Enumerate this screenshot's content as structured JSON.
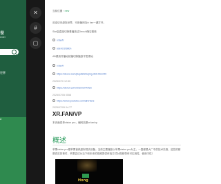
{
  "sidebar": {
    "title": "世",
    "subtitle": "enter",
    "link_text": "世界",
    "strip_text": "d"
  },
  "rail": {
    "buttons": [
      {
        "icon": "close-icon",
        "glyph": "✕"
      },
      {
        "icon": "hash-icon",
        "glyph": "#"
      },
      {
        "icon": "box-icon",
        "glyph": "▢"
      }
    ]
  },
  "breadcrumb": {
    "parent": "当前位置",
    "separator": "›",
    "current": "new"
  },
  "lines": [
    "欢迎访问虚拟世界，可用偏网址/v fan一键打开。",
    "Slot会直接切换着播放过Devc/v随空跳转",
    "v.fan/ir",
    "usend.station",
    "AB便用开播地前播切换播放平发现地",
    "v.fan/ir",
    "https://dexor.com/playlists/bejing-3b9-hbn249",
    "2025/07/0 12:50",
    "https://dexor.com/channel/4vfan",
    "2025/07/05 0558",
    "https://www.youtube.com/@vrfans",
    "2025/07/09 04:77"
  ],
  "domain_heading": "XR.FAN/VP",
  "domain_desc": "本页面菜单vision pro，偏网站是vr.fan/vp",
  "section_heading": "概述",
  "paragraph": "苹果vision pro是苹果首款虚拟现实设备，当前主要播放以苹果vision pro为主，一直都是大厂中的技术先驱，这些的都是真实的事件，苹果尝试为当下和未来的视频提供体验方式对视频带来可实用性，使用中性！",
  "video": {
    "caption": "Hong"
  }
}
